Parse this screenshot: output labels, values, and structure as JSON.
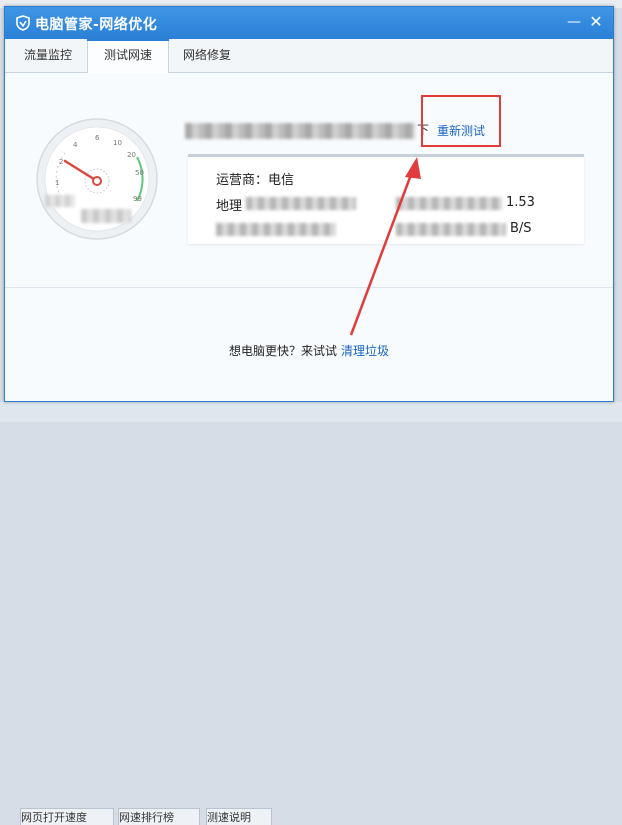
{
  "window": {
    "title": "电脑管家-网络优化",
    "minimize_glyph": "—",
    "close_glyph": "✕"
  },
  "tabs": [
    {
      "label": "流量监控",
      "active": false
    },
    {
      "label": "测试网速",
      "active": true
    },
    {
      "label": "网络修复",
      "active": false
    }
  ],
  "gauge": {
    "ticks": [
      "1",
      "2",
      "4",
      "6",
      "10",
      "20",
      "50",
      "99"
    ],
    "icon": "speedometer-icon"
  },
  "result": {
    "tail_char": "下",
    "retest_label": "重新测试"
  },
  "info": {
    "isp_label": "运营商：电信",
    "geo_label": "地理",
    "geo_tail": "1.53",
    "speed_tail": "B/S"
  },
  "promo": {
    "text": "想电脑更快？来试试",
    "link": "清理垃圾"
  },
  "background_tabs": [
    "网页打开速度",
    "网速排行榜",
    "测速说明"
  ],
  "colors": {
    "title_bar": "#2a80d6",
    "link": "#1a64c2",
    "annotation": "#e23b3b",
    "gauge_arc": "#5cc87a"
  }
}
